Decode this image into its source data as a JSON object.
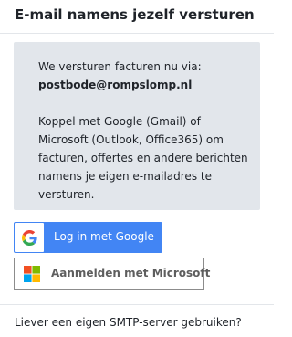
{
  "header": {
    "title": "E-mail namens jezelf versturen"
  },
  "info": {
    "intro": "We versturen facturen nu via:",
    "sender_address": "postbode@rompslomp.nl",
    "line1": "Koppel met Google (Gmail) of",
    "line2": "Microsoft (Outlook, Office365) om",
    "line3": "facturen, offertes en andere berichten",
    "line4": "namens je eigen e-mailadres te",
    "line5": "versturen."
  },
  "actions": {
    "google_label": "Log in met Google",
    "microsoft_label": "Aanmelden met Microsoft"
  },
  "footer": {
    "smtp_link": "Liever een eigen SMTP-server gebruiken?"
  },
  "colors": {
    "google_blue": "#4285f4",
    "info_bg": "#e2e6eb"
  },
  "icons": {
    "google": "google-g-icon",
    "microsoft": "microsoft-logo-icon"
  }
}
